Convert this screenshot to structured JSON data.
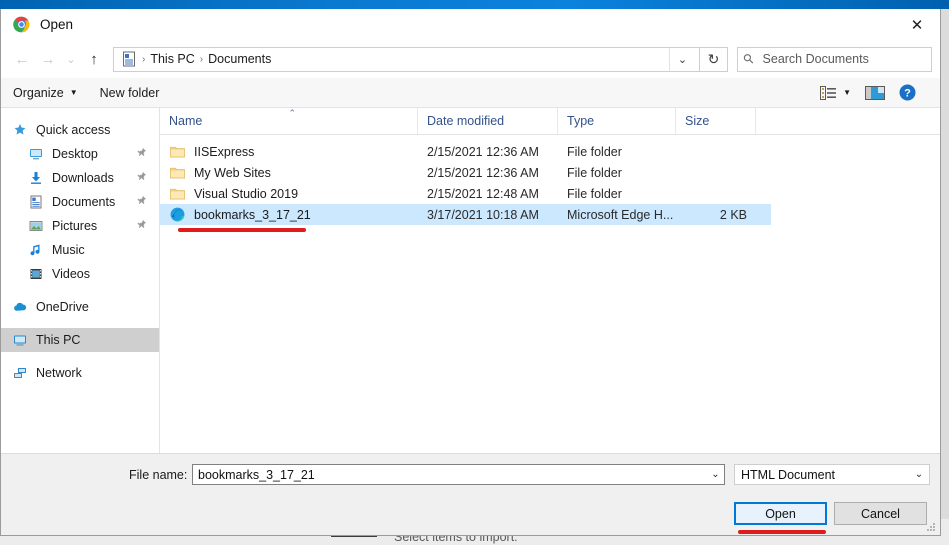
{
  "dialog": {
    "title": "Open",
    "app_icon": "chrome-icon",
    "close_label": "✕"
  },
  "nav": {
    "back": "←",
    "forward": "→",
    "recent": "⌄",
    "up": "↑",
    "breadcrumb": [
      "This PC",
      "Documents"
    ],
    "separator": "›",
    "address_dropdown": "⌄",
    "refresh": "↻"
  },
  "search": {
    "placeholder": "Search Documents",
    "icon": "search-icon"
  },
  "commandbar": {
    "organize": "Organize",
    "organize_caret": "▼",
    "new_folder": "New folder",
    "view_caret": "▼",
    "help": "?"
  },
  "sidebar": {
    "items": [
      {
        "label": "Quick access",
        "icon": "star-icon",
        "indent": false,
        "pinned": false,
        "selected": false,
        "gap": false
      },
      {
        "label": "Desktop",
        "icon": "desktop-icon",
        "indent": true,
        "pinned": true,
        "selected": false,
        "gap": false
      },
      {
        "label": "Downloads",
        "icon": "download-icon",
        "indent": true,
        "pinned": true,
        "selected": false,
        "gap": false
      },
      {
        "label": "Documents",
        "icon": "documents-icon",
        "indent": true,
        "pinned": true,
        "selected": false,
        "gap": false
      },
      {
        "label": "Pictures",
        "icon": "pictures-icon",
        "indent": true,
        "pinned": true,
        "selected": false,
        "gap": false
      },
      {
        "label": "Music",
        "icon": "music-icon",
        "indent": true,
        "pinned": false,
        "selected": false,
        "gap": false
      },
      {
        "label": "Videos",
        "icon": "videos-icon",
        "indent": true,
        "pinned": false,
        "selected": false,
        "gap": false
      },
      {
        "label": "OneDrive",
        "icon": "cloud-icon",
        "indent": false,
        "pinned": false,
        "selected": false,
        "gap": true
      },
      {
        "label": "This PC",
        "icon": "thispc-icon",
        "indent": false,
        "pinned": false,
        "selected": true,
        "gap": true
      },
      {
        "label": "Network",
        "icon": "network-icon",
        "indent": false,
        "pinned": false,
        "selected": false,
        "gap": true
      }
    ],
    "pin_glyph": "📌"
  },
  "filelist": {
    "columns": [
      "Name",
      "Date modified",
      "Type",
      "Size"
    ],
    "sort_caret": "⌃",
    "rows": [
      {
        "name": "IISExpress",
        "date": "2/15/2021 12:36 AM",
        "type": "File folder",
        "size": "",
        "icon": "folder-icon",
        "selected": false
      },
      {
        "name": "My Web Sites",
        "date": "2/15/2021 12:36 AM",
        "type": "File folder",
        "size": "",
        "icon": "folder-icon",
        "selected": false
      },
      {
        "name": "Visual Studio 2019",
        "date": "2/15/2021 12:48 AM",
        "type": "File folder",
        "size": "",
        "icon": "folder-icon",
        "selected": false
      },
      {
        "name": "bookmarks_3_17_21",
        "date": "3/17/2021 10:18 AM",
        "type": "Microsoft Edge H...",
        "size": "2 KB",
        "icon": "edge-icon",
        "selected": true
      }
    ]
  },
  "bottom": {
    "filename_label": "File name:",
    "filename_value": "bookmarks_3_17_21",
    "filename_dropdown": "⌄",
    "filetype_value": "HTML Document",
    "filetype_dropdown": "⌄",
    "open_label": "Open",
    "cancel_label": "Cancel"
  },
  "background": {
    "import_text": "Select items to import:"
  },
  "colors": {
    "accent": "#0078d7",
    "selection": "#cce8ff",
    "annotation": "#e01b1b",
    "header_text": "#33518a"
  }
}
